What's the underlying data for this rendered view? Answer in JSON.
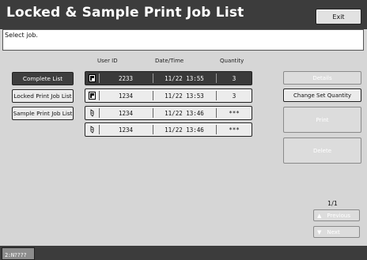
{
  "title": "Locked & Sample Print Job List",
  "exit_label": "Exit",
  "message": "Select job.",
  "columns": {
    "user_id": "User ID",
    "datetime": "Date/Time",
    "quantity": "Quantity"
  },
  "left_buttons": [
    {
      "label": "Complete List"
    },
    {
      "label": "Locked Print Job List"
    },
    {
      "label": "Sample Print Job List"
    }
  ],
  "jobs": [
    {
      "type_icon": "locked-job-icon",
      "user_id": "2233",
      "datetime": "11/22 13:55",
      "quantity": "3"
    },
    {
      "type_icon": "locked-job-icon",
      "user_id": "1234",
      "datetime": "11/22 13:53",
      "quantity": "3"
    },
    {
      "type_icon": "sample-job-icon",
      "user_id": "1234",
      "datetime": "11/22 13:46",
      "quantity": "***"
    },
    {
      "type_icon": "sample-job-icon",
      "user_id": "1234",
      "datetime": "11/22 13:46",
      "quantity": "***"
    }
  ],
  "right_buttons": {
    "details": "Details",
    "change_qty": "Change Set Quantity",
    "print": "Print",
    "delete": "Delete"
  },
  "page_indicator": "1/1",
  "nav": {
    "previous": "Previous",
    "next": "Next"
  },
  "tray_label": "2:N????"
}
